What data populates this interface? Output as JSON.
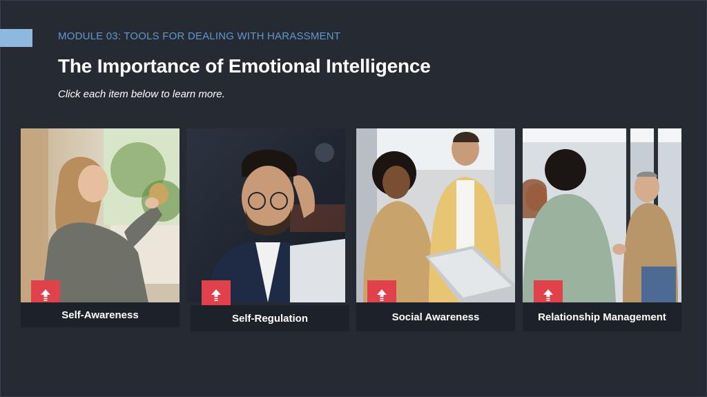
{
  "header": {
    "module_label": "MODULE 03: TOOLS FOR DEALING WITH HARASSMENT",
    "title": "The Importance of Emotional Intelligence",
    "instruction": "Click each item below to learn more."
  },
  "colors": {
    "background": "#252a33",
    "accent": "#8fb8de",
    "module_text": "#5f98d4",
    "badge": "#e0414a",
    "caption_bg": "#1d2129"
  },
  "cards": [
    {
      "label": "Self-Awareness",
      "icon": "upload-arrow-icon"
    },
    {
      "label": "Self-Regulation",
      "icon": "upload-arrow-icon"
    },
    {
      "label": "Social Awareness",
      "icon": "upload-arrow-icon"
    },
    {
      "label": "Relationship Management",
      "icon": "upload-arrow-icon"
    }
  ]
}
